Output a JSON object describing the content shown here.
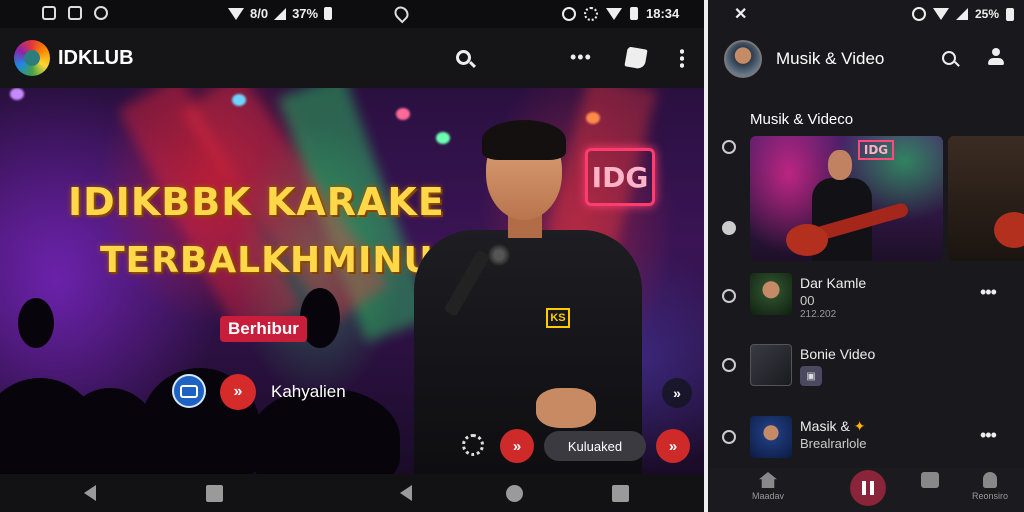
{
  "left_status": {
    "battery": "8/0",
    "percent": "37%",
    "time": "18:34"
  },
  "left_app": {
    "title": "IDKLUB"
  },
  "hero": {
    "title_line1": "IDIKBBK KARAKE",
    "title_line2": "TERBALKHMINU",
    "tag": "Berhibur",
    "caption": "Kahyalien",
    "sign_text": "IDG",
    "shirt_logo": "KS"
  },
  "controls": {
    "pill_label": "Kuluaked"
  },
  "right_status": {
    "battery": "25%"
  },
  "right_app": {
    "title": "Musik & Video",
    "section_title": "Musik & Videco",
    "thumb_sign": "IDG"
  },
  "right_list": [
    {
      "line1": "Dar Kamle",
      "line2": "00",
      "line3": "212.202"
    },
    {
      "line1": "Bonie Video",
      "mini": "▣"
    },
    {
      "line1": "Masik &",
      "plus": "✦",
      "line2": "Brealrarlole"
    }
  ],
  "bottom_tabs": {
    "home": "Maadav",
    "account": "Reonsiro"
  },
  "glyphs": {
    "forward": "»",
    "more": "•••",
    "back_x": "✕"
  },
  "colors": {
    "accent_red": "#d62b2b",
    "title_yellow": "#ffd84a",
    "cast_blue": "#1e63c4",
    "pause_bg": "#8a2438"
  }
}
